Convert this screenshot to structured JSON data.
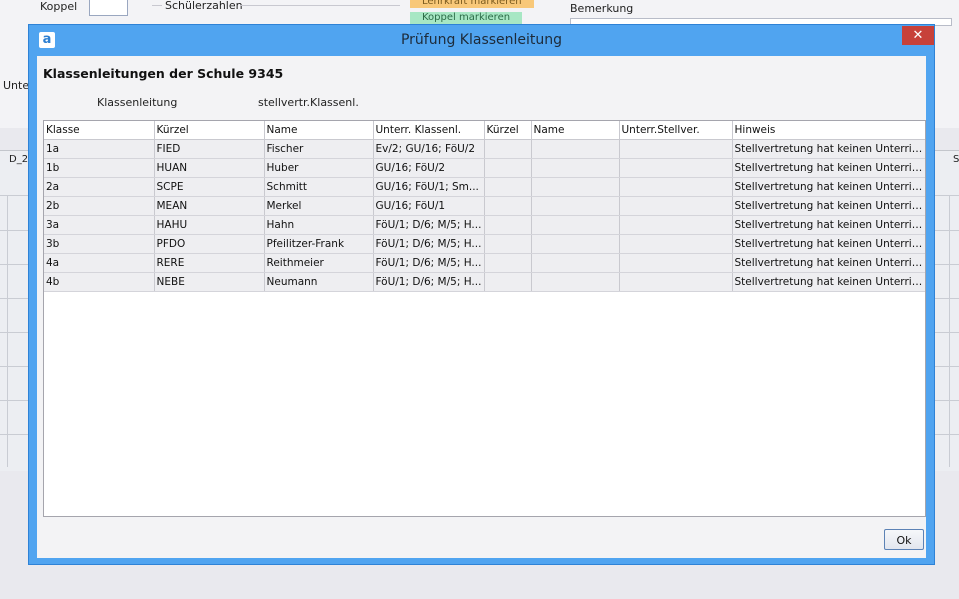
{
  "background": {
    "koppel_label": "Koppel",
    "schuelerzahlen_label": "Schülerzahlen",
    "lehrkraft_markieren": "Lehrkraft markieren",
    "koppel_markieren": "Koppel markieren",
    "bemerkung_label": "Bemerkung",
    "unter_label": "Unte",
    "d_label": "D_2",
    "s_label": "S"
  },
  "dialog": {
    "title": "Prüfung Klassenleitung",
    "close_glyph": "✕",
    "icon_letter": "a",
    "heading": "Klassenleitungen der Schule 9345",
    "label_klassenleitung": "Klassenleitung",
    "label_stellvertr": "stellvertr.Klassenl.",
    "ok_label": "Ok",
    "columns": [
      "Klasse",
      "Kürzel",
      "Name",
      "Unterr. Klassenl.",
      "Kürzel",
      "Name",
      "Unterr.Stellver.",
      "Hinweis"
    ],
    "rows": [
      {
        "klasse": "1a",
        "kuerzel": "FIED",
        "name": "Fischer",
        "unterr": "Ev/2; GU/16; FöU/2",
        "s_kuerzel": "",
        "s_name": "",
        "s_unterr": "",
        "hinweis": "Stellvertretung hat keinen Unterric..."
      },
      {
        "klasse": "1b",
        "kuerzel": "HUAN",
        "name": "Huber",
        "unterr": "GU/16; FöU/2",
        "s_kuerzel": "",
        "s_name": "",
        "s_unterr": "",
        "hinweis": "Stellvertretung hat keinen Unterric..."
      },
      {
        "klasse": "2a",
        "kuerzel": "SCPE",
        "name": "Schmitt",
        "unterr": "GU/16; FöU/1; Sm...",
        "s_kuerzel": "",
        "s_name": "",
        "s_unterr": "",
        "hinweis": "Stellvertretung hat keinen Unterric..."
      },
      {
        "klasse": "2b",
        "kuerzel": "MEAN",
        "name": "Merkel",
        "unterr": "GU/16; FöU/1",
        "s_kuerzel": "",
        "s_name": "",
        "s_unterr": "",
        "hinweis": "Stellvertretung hat keinen Unterric..."
      },
      {
        "klasse": "3a",
        "kuerzel": "HAHU",
        "name": "Hahn",
        "unterr": "FöU/1; D/6; M/5; H...",
        "s_kuerzel": "",
        "s_name": "",
        "s_unterr": "",
        "hinweis": "Stellvertretung hat keinen Unterric..."
      },
      {
        "klasse": "3b",
        "kuerzel": "PFDO",
        "name": "Pfeilitzer-Frank",
        "unterr": "FöU/1; D/6; M/5; H...",
        "s_kuerzel": "",
        "s_name": "",
        "s_unterr": "",
        "hinweis": "Stellvertretung hat keinen Unterric..."
      },
      {
        "klasse": "4a",
        "kuerzel": "RERE",
        "name": "Reithmeier",
        "unterr": "FöU/1; D/6; M/5; H...",
        "s_kuerzel": "",
        "s_name": "",
        "s_unterr": "",
        "hinweis": "Stellvertretung hat keinen Unterric..."
      },
      {
        "klasse": "4b",
        "kuerzel": "NEBE",
        "name": "Neumann",
        "unterr": "FöU/1; D/6; M/5; H...",
        "s_kuerzel": "",
        "s_name": "",
        "s_unterr": "",
        "hinweis": "Stellvertretung hat keinen Unterric..."
      }
    ]
  },
  "colors": {
    "titlebar": "#50a4f0",
    "close": "#c7413a",
    "tag_lehrkraft": "#f8c879",
    "tag_koppel": "#a7e7c4"
  }
}
